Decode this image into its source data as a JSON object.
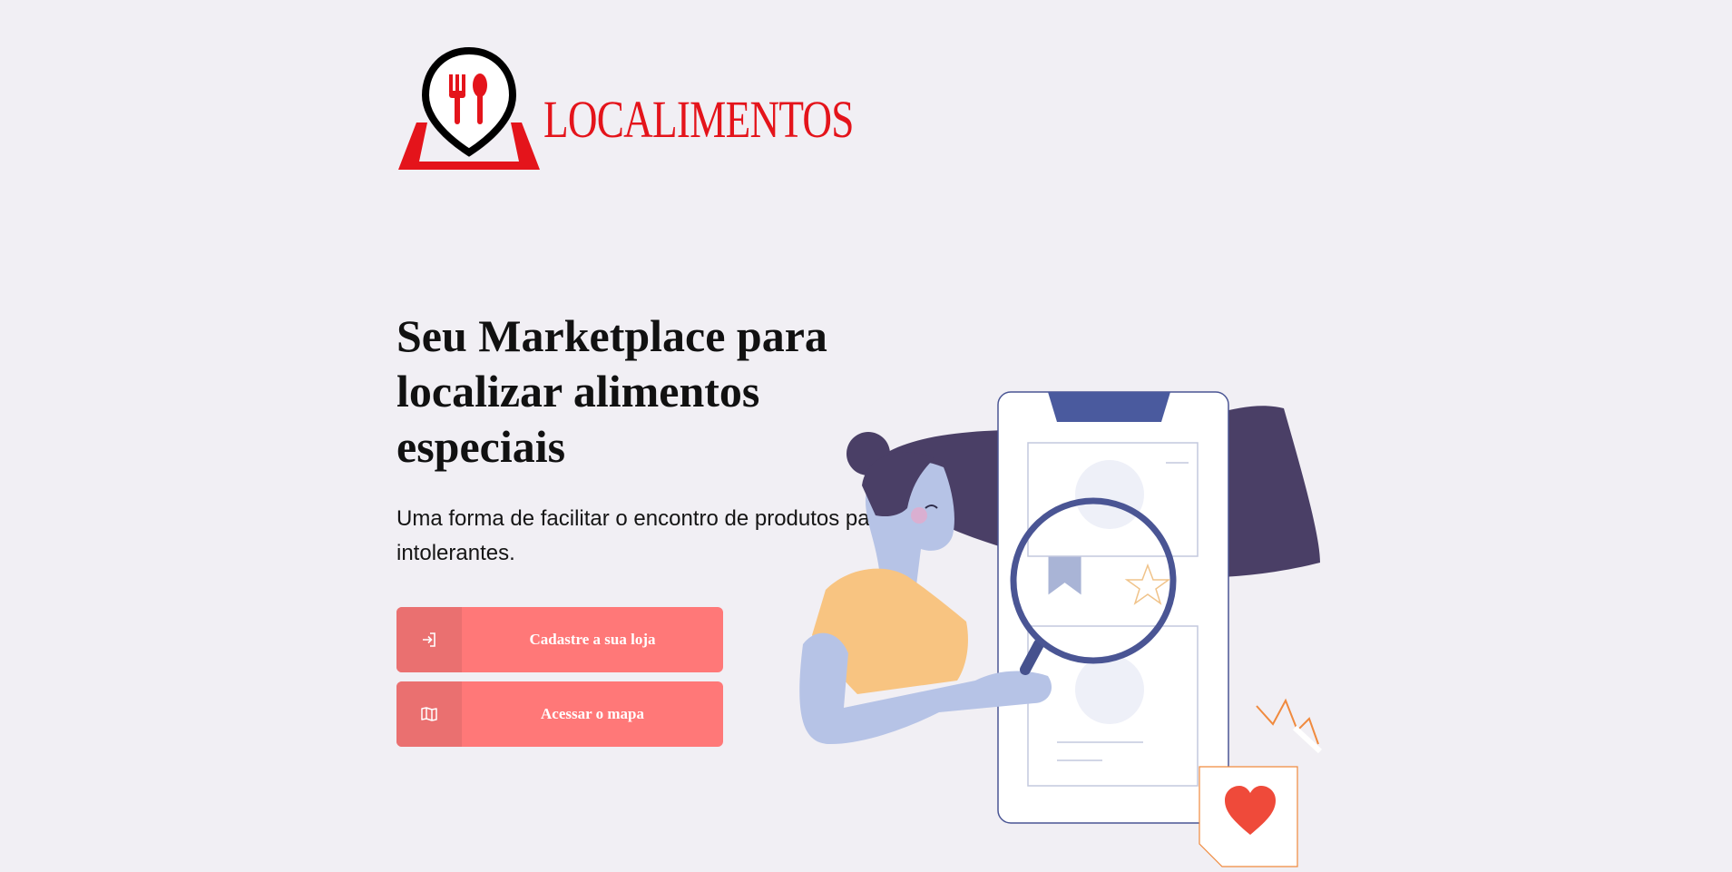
{
  "brand": {
    "name": "LOCALIMENTOS",
    "primary_color": "#e4141b"
  },
  "hero": {
    "title": "Seu Marketplace para localizar alimentos especiais",
    "subtitle": "Uma forma de facilitar o encontro de produtos para intolerantes."
  },
  "actions": {
    "register": {
      "label": "Cadastre a sua loja",
      "icon": "login-icon"
    },
    "map": {
      "label": "Acessar o mapa",
      "icon": "map-icon"
    }
  },
  "colors": {
    "background": "#f1eff4",
    "button": "#ff7878",
    "button_icon_bg": "#ea7070",
    "accent_dark": "#4a3f66"
  }
}
